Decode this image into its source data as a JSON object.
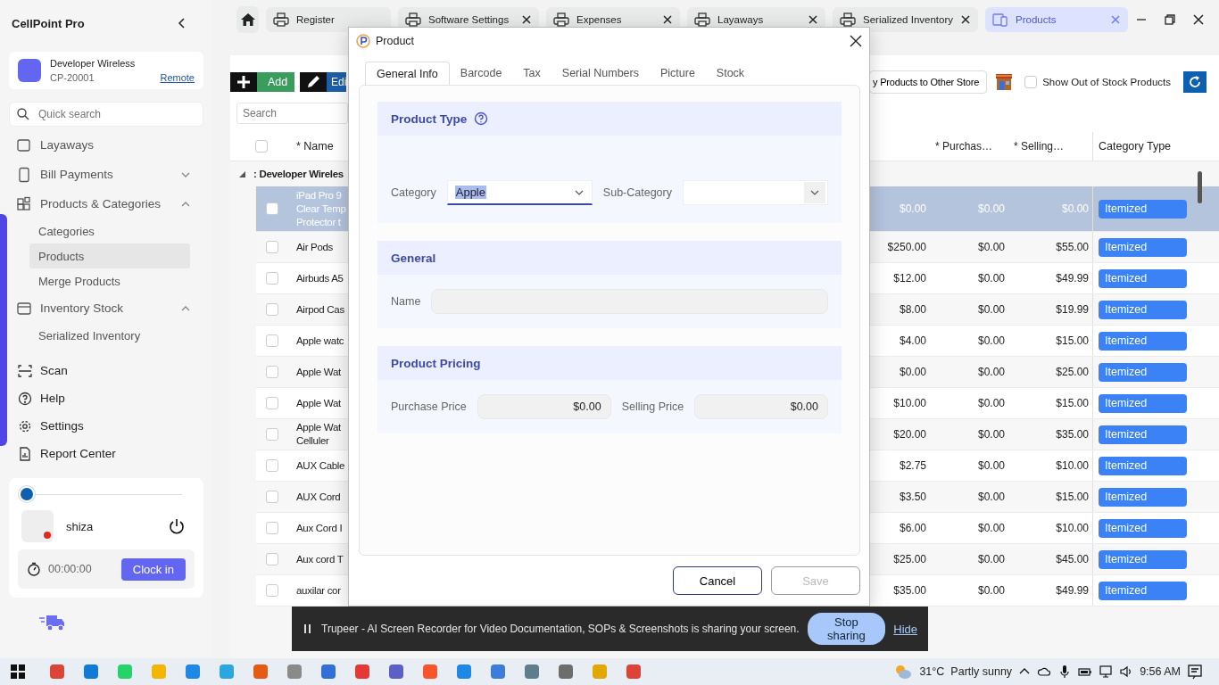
{
  "sidebar": {
    "app_title": "CellPoint Pro",
    "store": {
      "name": "Developer Wireless",
      "code": "CP-20001",
      "link": "Remote"
    },
    "search": {
      "placeholder": "Quick search"
    },
    "nav": [
      {
        "label": "Layaways",
        "kind": "link",
        "selected": false
      },
      {
        "label": "Bill Payments",
        "kind": "group",
        "expanded": false,
        "selected": false
      },
      {
        "label": "Products & Categories",
        "kind": "group",
        "expanded": true,
        "selected": false,
        "children": [
          {
            "label": "Categories",
            "selected": false
          },
          {
            "label": "Products",
            "selected": true
          },
          {
            "label": "Merge Products",
            "selected": false
          }
        ]
      },
      {
        "label": "Inventory Stock",
        "kind": "group",
        "expanded": true,
        "selected": false,
        "children": [
          {
            "label": "Serialized Inventory",
            "selected": false
          }
        ]
      }
    ],
    "links": [
      {
        "label": "Scan"
      },
      {
        "label": "Help"
      },
      {
        "label": "Settings"
      },
      {
        "label": "Report Center"
      }
    ],
    "user": {
      "level": 0,
      "name": "shiza",
      "timer": "00:00:00",
      "clock_button": "Clock in"
    }
  },
  "tabs": [
    {
      "label": "Register",
      "selected": false,
      "closable": false
    },
    {
      "label": "Software Settings",
      "selected": false,
      "closable": true
    },
    {
      "label": "Expenses",
      "selected": false,
      "closable": true
    },
    {
      "label": "Layaways",
      "selected": false,
      "closable": true
    },
    {
      "label": "Serialized Inventory",
      "selected": false,
      "closable": true
    },
    {
      "label": "Products",
      "selected": true,
      "closable": true
    }
  ],
  "toolbar": {
    "add": "Add",
    "edit": "Edi",
    "copy": "y Products to Other Store",
    "out_of_stock": {
      "label": "Show Out of Stock Products",
      "checked": false
    }
  },
  "table": {
    "search_placeholder": "Search",
    "all_checked": false,
    "columns": {
      "name": "* Name",
      "purchase": "* Purchas…",
      "selling": "* Selling…",
      "category_type": "Category Type"
    },
    "group": ": Developer Wireles",
    "rows": [
      {
        "selected": true,
        "checked": false,
        "name": [
          "iPad Pro 9",
          "Clear Temp",
          "Protector t"
        ],
        "column_3": "$0.00",
        "purchase": "$0.00",
        "selling": "$0.00",
        "category_type": "Itemized"
      },
      {
        "selected": false,
        "checked": false,
        "name": [
          "Air Pods"
        ],
        "column_3": "$250.00",
        "purchase": "$0.00",
        "selling": "$55.00",
        "category_type": "Itemized"
      },
      {
        "selected": false,
        "checked": false,
        "name": [
          "Airbuds A5"
        ],
        "column_3": "$12.00",
        "purchase": "$0.00",
        "selling": "$49.99",
        "category_type": "Itemized"
      },
      {
        "selected": false,
        "checked": false,
        "name": [
          "Airpod Cas"
        ],
        "column_3": "$8.00",
        "purchase": "$0.00",
        "selling": "$19.99",
        "category_type": "Itemized"
      },
      {
        "selected": false,
        "checked": false,
        "name": [
          "Apple watc"
        ],
        "column_3": "$4.00",
        "purchase": "$0.00",
        "selling": "$15.00",
        "category_type": "Itemized"
      },
      {
        "selected": false,
        "checked": false,
        "name": [
          "Apple Wat"
        ],
        "column_3": "$0.00",
        "purchase": "$0.00",
        "selling": "$25.00",
        "category_type": "Itemized"
      },
      {
        "selected": false,
        "checked": false,
        "name": [
          "Apple Wat"
        ],
        "column_3": "$10.00",
        "purchase": "$0.00",
        "selling": "$15.00",
        "category_type": "Itemized"
      },
      {
        "selected": false,
        "checked": false,
        "name": [
          "Apple Wat",
          "Celluler"
        ],
        "column_3": "$20.00",
        "purchase": "$0.00",
        "selling": "$35.00",
        "category_type": "Itemized"
      },
      {
        "selected": false,
        "checked": false,
        "name": [
          "AUX Cable"
        ],
        "column_3": "$2.75",
        "purchase": "$0.00",
        "selling": "$10.00",
        "category_type": "Itemized"
      },
      {
        "selected": false,
        "checked": false,
        "name": [
          "AUX Cord"
        ],
        "column_3": "$3.50",
        "purchase": "$0.00",
        "selling": "$15.00",
        "category_type": "Itemized"
      },
      {
        "selected": false,
        "checked": false,
        "name": [
          "Aux Cord I"
        ],
        "column_3": "$6.00",
        "purchase": "$0.00",
        "selling": "$10.00",
        "category_type": "Itemized"
      },
      {
        "selected": false,
        "checked": false,
        "name": [
          "Aux cord T"
        ],
        "column_3": "$25.00",
        "purchase": "$0.00",
        "selling": "$45.00",
        "category_type": "Itemized"
      },
      {
        "selected": false,
        "checked": false,
        "name": [
          "auxilar cor"
        ],
        "column_3": "$35.00",
        "purchase": "$0.00",
        "selling": "$49.99",
        "category_type": "Itemized"
      }
    ]
  },
  "modal": {
    "title": "Product",
    "tabs": [
      {
        "label": "General Info",
        "selected": true
      },
      {
        "label": "Barcode",
        "selected": false
      },
      {
        "label": "Tax",
        "selected": false
      },
      {
        "label": "Serial Numbers",
        "selected": false
      },
      {
        "label": "Picture",
        "selected": false
      },
      {
        "label": "Stock",
        "selected": false
      }
    ],
    "product_type": {
      "heading": "Product Type",
      "category_label": "Category",
      "category_value": "Apple",
      "subcategory_label": "Sub-Category"
    },
    "general": {
      "heading": "General",
      "name_label": "Name"
    },
    "pricing": {
      "heading": "Product Pricing",
      "purchase_label": "Purchase Price",
      "purchase_value": "$0.00",
      "selling_label": "Selling Price",
      "selling_value": "$0.00"
    },
    "buttons": [
      {
        "label": "Cancel",
        "disabled": false
      },
      {
        "label": "Save",
        "disabled": true
      }
    ]
  },
  "screen_share": {
    "message": "Trupeer - AI Screen Recorder for Video Documentation, SOPs & Screenshots is sharing your screen.",
    "stop": "Stop sharing",
    "hide": "Hide"
  },
  "taskbar": {
    "temperature": "31°C",
    "weather": "Partly sunny",
    "time": "9:56 AM"
  }
}
